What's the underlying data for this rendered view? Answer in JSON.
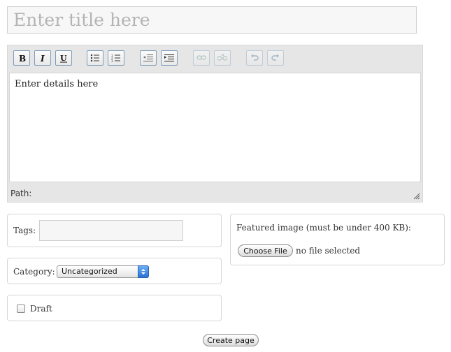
{
  "title_field": {
    "placeholder": "Enter title here",
    "value": ""
  },
  "editor": {
    "toolbar": [
      {
        "name": "bold-button",
        "icon": "bold-icon"
      },
      {
        "name": "italic-button",
        "icon": "italic-icon"
      },
      {
        "name": "underline-button",
        "icon": "underline-icon"
      },
      {
        "name": "bullet-list-button",
        "icon": "bullet-list-icon"
      },
      {
        "name": "numbered-list-button",
        "icon": "numbered-list-icon"
      },
      {
        "name": "outdent-button",
        "icon": "outdent-icon"
      },
      {
        "name": "indent-button",
        "icon": "indent-icon"
      },
      {
        "name": "link-button",
        "icon": "link-icon",
        "disabled": true
      },
      {
        "name": "unlink-button",
        "icon": "unlink-icon",
        "disabled": true
      },
      {
        "name": "undo-button",
        "icon": "undo-icon",
        "disabled": true
      },
      {
        "name": "redo-button",
        "icon": "redo-icon",
        "disabled": true
      }
    ],
    "body_text": "Enter details here",
    "path_label": "Path:"
  },
  "tags": {
    "label": "Tags:",
    "value": ""
  },
  "category": {
    "label": "Category:",
    "selected": "Uncategorized"
  },
  "draft": {
    "label": "Draft",
    "checked": false
  },
  "featured_image": {
    "label": "Featured image (must be under 400 KB):",
    "choose_button": "Choose File",
    "status": "no file selected"
  },
  "submit": {
    "label": "Create page"
  },
  "colors": {
    "toolbar_bg": "#e6e6e6",
    "button_border": "#7f9db9",
    "select_arrow": "#2b73d3"
  }
}
